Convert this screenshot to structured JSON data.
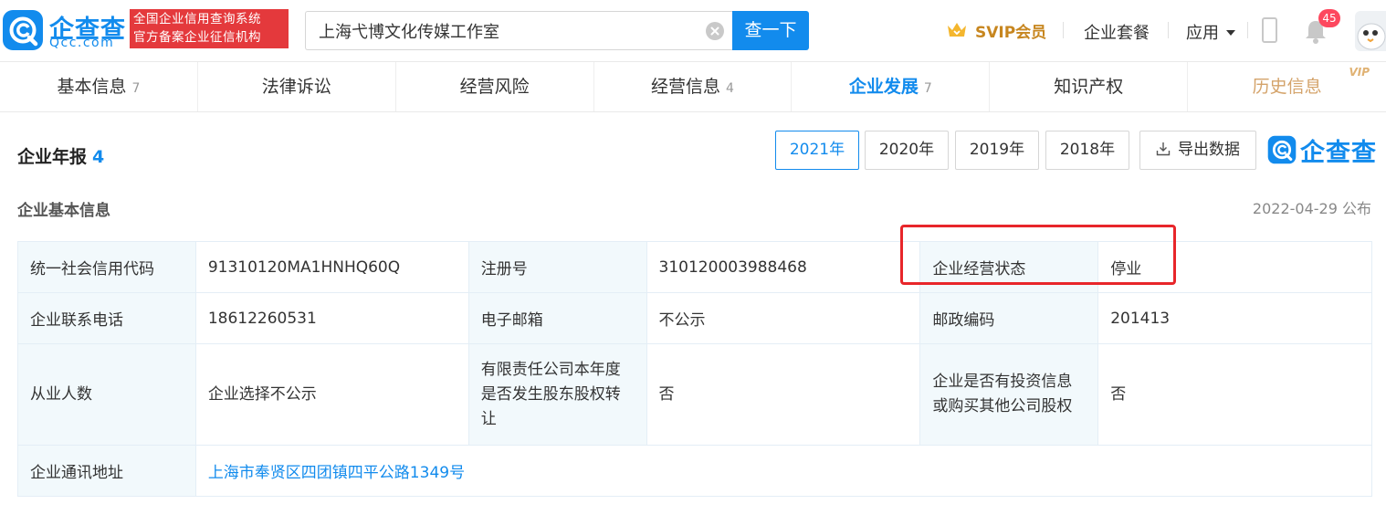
{
  "brand": {
    "logo_text": "企查查",
    "logo_sub": "Qcc.com",
    "slogan_line1": "全国企业信用查询系统",
    "slogan_line2": "官方备案企业征信机构"
  },
  "search": {
    "value": "上海弋博文化传媒工作室",
    "button_label": "查一下"
  },
  "header_nav": {
    "svip_label": "SVIP会员",
    "package_label": "企业套餐",
    "apps_label": "应用",
    "notification_count": "45"
  },
  "tabs": [
    {
      "label": "基本信息",
      "count": "7"
    },
    {
      "label": "法律诉讼",
      "count": ""
    },
    {
      "label": "经营风险",
      "count": ""
    },
    {
      "label": "经营信息",
      "count": "4"
    },
    {
      "label": "企业发展",
      "count": "7"
    },
    {
      "label": "知识产权",
      "count": ""
    },
    {
      "label": "历史信息",
      "count": "",
      "tag": "VIP"
    }
  ],
  "active_tab": "企业发展",
  "section": {
    "title": "企业年报",
    "count": "4",
    "years": [
      "2021年",
      "2020年",
      "2019年",
      "2018年"
    ],
    "active_year": "2021年",
    "export_label": "导出数据",
    "brand_mark": "企查查",
    "sub_title": "企业基本信息",
    "publish_date": "2022-04-29 公布"
  },
  "report": {
    "credit_code_label": "统一社会信用代码",
    "credit_code": "91310120MA1HNHQ60Q",
    "reg_no_label": "注册号",
    "reg_no": "310120003988468",
    "status_label": "企业经营状态",
    "status": "停业",
    "phone_label": "企业联系电话",
    "phone": "18612260531",
    "email_label": "电子邮箱",
    "email": "不公示",
    "postcode_label": "邮政编码",
    "postcode": "201413",
    "employees_label": "从业人数",
    "employees": "企业选择不公示",
    "equity_transfer_label": "有限责任公司本年度是否发生股东股权转让",
    "equity_transfer": "否",
    "investment_label": "企业是否有投资信息或购买其他公司股权",
    "investment": "否",
    "address_label": "企业通讯地址",
    "address": "上海市奉贤区四团镇四平公路1349号"
  },
  "colors": {
    "accent": "#128bed",
    "slogan_bg": "#e4393c",
    "highlight": "#e8262a",
    "label_bg": "#f2f9fc",
    "vip_gold": "#c7861f"
  }
}
